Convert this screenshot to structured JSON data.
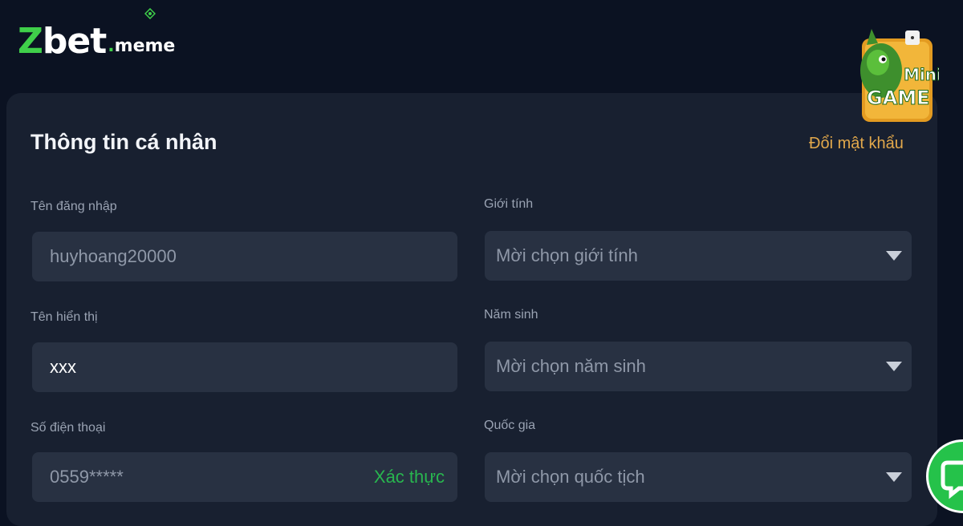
{
  "brand": {
    "logo_main": "Zbet",
    "logo_domain": ".meme"
  },
  "page": {
    "title": "Thông tin cá nhân",
    "change_password_link": "Đổi mật khẩu"
  },
  "form": {
    "username": {
      "label": "Tên đăng nhập",
      "value": "huyhoang20000"
    },
    "display_name": {
      "label": "Tên hiển thị",
      "value": "xxx"
    },
    "phone": {
      "label": "Số điện thoại",
      "value": "0559*****",
      "verify_label": "Xác thực"
    },
    "gender": {
      "label": "Giới tính",
      "placeholder": "Mời chọn giới tính"
    },
    "birth_year": {
      "label": "Năm sinh",
      "placeholder": "Mời chọn năm sinh"
    },
    "nationality": {
      "label": "Quốc gia",
      "placeholder": "Mời chọn quốc tịch"
    }
  },
  "widgets": {
    "minigame_label_top": "Mini",
    "minigame_label_bottom": "GAME",
    "chat_icon": "chat-bubble-icon"
  },
  "colors": {
    "background": "#0b1222",
    "panel": "#182030",
    "field": "#283142",
    "accent_orange": "#e2a84b",
    "accent_green": "#28b64f"
  }
}
